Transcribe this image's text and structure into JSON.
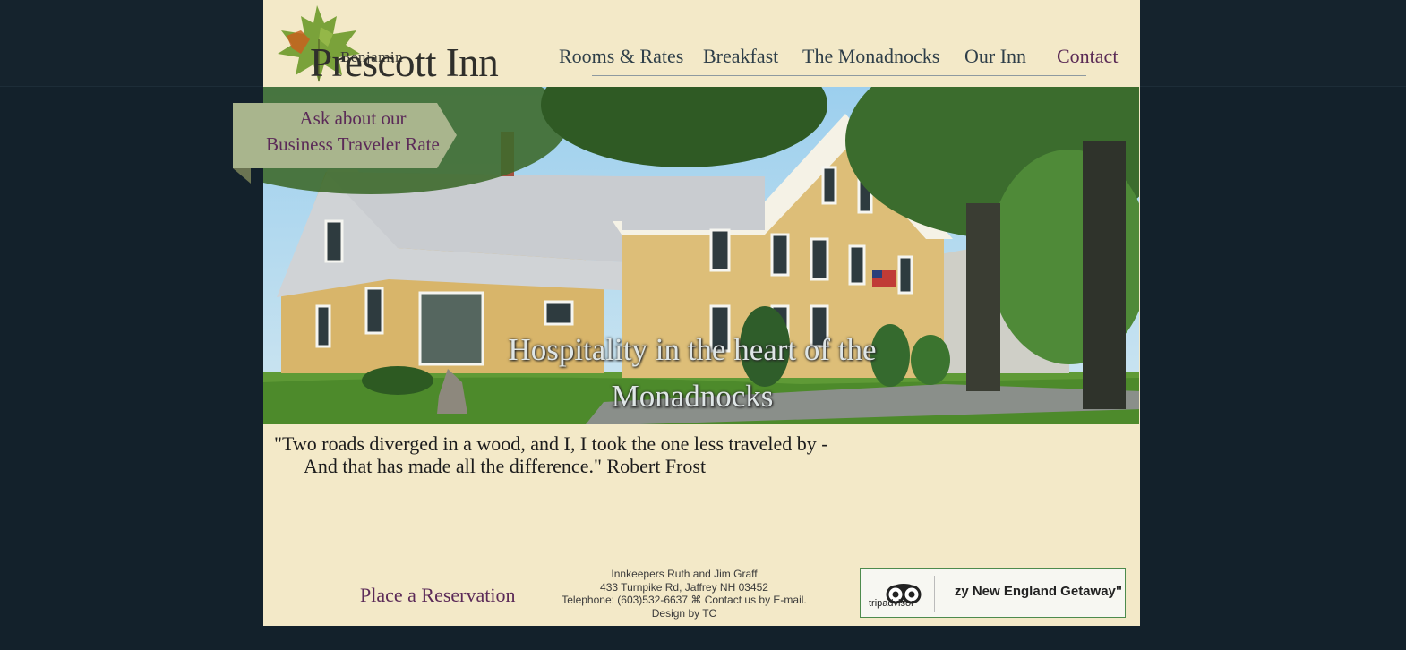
{
  "brand": {
    "logo_small": "Benjamin",
    "logo_big": "Prescott Inn"
  },
  "nav": {
    "items": [
      {
        "label": "Rooms & Rates"
      },
      {
        "label": "Breakfast"
      },
      {
        "label": "The Monadnocks"
      },
      {
        "label": "Our Inn"
      },
      {
        "label": "Contact"
      }
    ]
  },
  "promo": {
    "line1": "Ask about our",
    "line2": "Business Traveler Rate"
  },
  "hero": {
    "caption": "Hospitality in the heart of the Monadnocks"
  },
  "quote": {
    "line1": "\"Two roads diverged in a wood, and I, I took the one less traveled by -",
    "line2": "And that has made all the difference.\" Robert Frost"
  },
  "footer": {
    "reservation": "Place a Reservation",
    "innkeepers": "Innkeepers Ruth and Jim Graff",
    "address": "433 Turnpike Rd, Jaffrey NH 03452",
    "telephone": "Telephone: (603)532-6637",
    "separator": "⌘",
    "contact": "Contact us by E-mail.",
    "design": "Design by TC"
  },
  "tripadvisor": {
    "brand": "tripadvisor",
    "review": "zy New England Getaway\""
  },
  "colors": {
    "background": "#13212b",
    "page": "#f3e9c8",
    "accent": "#5b2a58",
    "nav": "#2f3f49"
  }
}
